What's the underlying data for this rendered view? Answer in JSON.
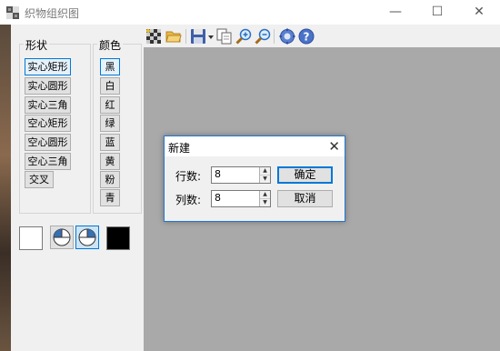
{
  "window": {
    "title": "织物组织图",
    "minimize": "—",
    "maximize": "☐",
    "close": "✕"
  },
  "shapes_group": {
    "label": "形状",
    "items": [
      "实心矩形",
      "实心圆形",
      "实心三角",
      "空心矩形",
      "空心圆形",
      "空心三角",
      "交叉"
    ],
    "selected_index": 0
  },
  "colors_group": {
    "label": "颜色",
    "items": [
      "黑",
      "白",
      "红",
      "绿",
      "蓝",
      "黄",
      "粉",
      "青"
    ],
    "selected_index": 0
  },
  "swatches": {
    "background_color": "#ffffff",
    "foreground_color": "#000000"
  },
  "toolbar": {
    "icons": [
      "grid-icon",
      "open-folder-icon",
      "save-icon",
      "dropdown-arrow-icon",
      "copy-icon",
      "zoom-in-icon",
      "zoom-out-icon",
      "settings-icon",
      "help-icon"
    ]
  },
  "dialog": {
    "title": "新建",
    "close": "✕",
    "rows_label": "行数:",
    "rows_value": "8",
    "cols_label": "列数:",
    "cols_value": "8",
    "ok_label": "确定",
    "cancel_label": "取消"
  },
  "colors": {
    "canvas_bg": "#a9a9a9",
    "accent": "#0078d7"
  }
}
